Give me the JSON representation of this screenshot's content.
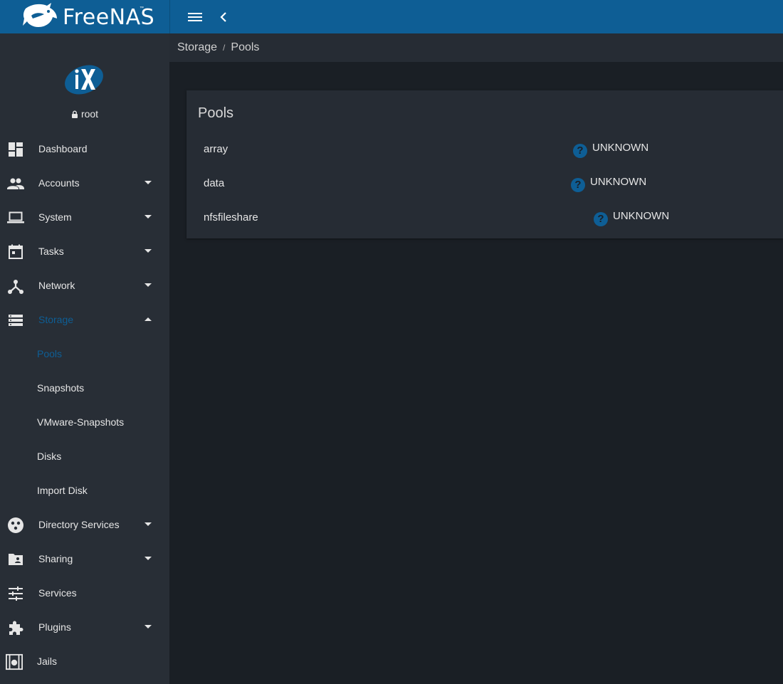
{
  "app": {
    "name": "FreeNAS",
    "tm": "™"
  },
  "user": {
    "name": "root"
  },
  "sidebar": {
    "items": [
      {
        "label": "Dashboard",
        "icon": "dashboard-icon",
        "has_caret": false
      },
      {
        "label": "Accounts",
        "icon": "people-icon",
        "has_caret": true
      },
      {
        "label": "System",
        "icon": "laptop-icon",
        "has_caret": true
      },
      {
        "label": "Tasks",
        "icon": "calendar-icon",
        "has_caret": true
      },
      {
        "label": "Network",
        "icon": "network-icon",
        "has_caret": true
      },
      {
        "label": "Storage",
        "icon": "storage-icon",
        "has_caret": true,
        "expanded": true
      },
      {
        "label": "Directory Services",
        "icon": "directory-services-icon",
        "has_caret": true
      },
      {
        "label": "Sharing",
        "icon": "folder-shared-icon",
        "has_caret": true
      },
      {
        "label": "Services",
        "icon": "tune-icon",
        "has_caret": false
      },
      {
        "label": "Plugins",
        "icon": "puzzle-icon",
        "has_caret": true
      },
      {
        "label": "Jails",
        "icon": "jail-icon",
        "has_caret": false
      }
    ],
    "storage_sub": [
      {
        "label": "Pools",
        "active": true
      },
      {
        "label": "Snapshots"
      },
      {
        "label": "VMware-Snapshots"
      },
      {
        "label": "Disks"
      },
      {
        "label": "Import Disk"
      }
    ]
  },
  "breadcrumb": {
    "parent": "Storage",
    "separator": "/",
    "current": "Pools"
  },
  "pools_card": {
    "title": "Pools",
    "rows": [
      {
        "name": "array",
        "status": "UNKNOWN",
        "status_icon": "help-circle-icon"
      },
      {
        "name": "data",
        "status": "UNKNOWN",
        "status_icon": "help-circle-icon"
      },
      {
        "name": "nfsfileshare",
        "status": "UNKNOWN",
        "status_icon": "help-circle-icon"
      }
    ]
  },
  "colors": {
    "topbar": "#0e5e95",
    "sidebar": "#282e36",
    "content": "#1a1f25",
    "card": "#262c34",
    "accent": "#0e5e95"
  }
}
